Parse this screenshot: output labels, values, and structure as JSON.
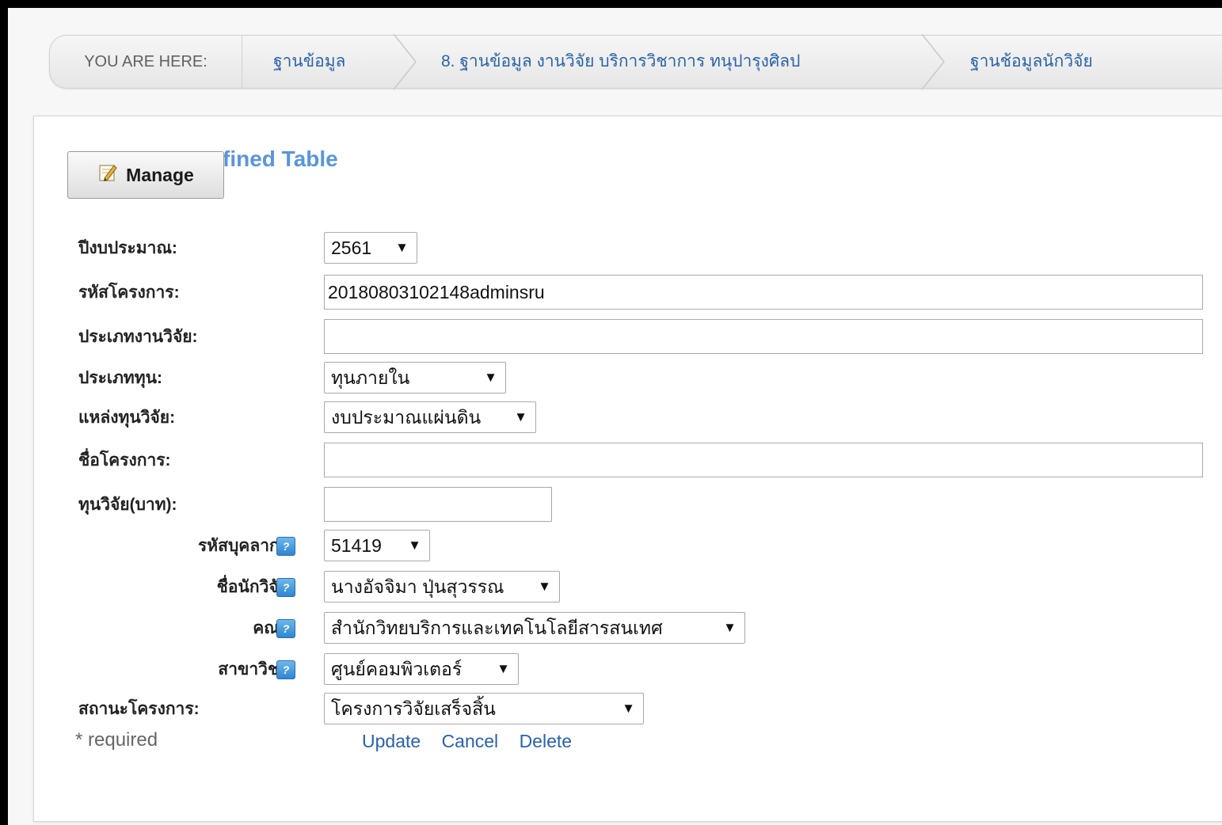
{
  "breadcrumb": {
    "you_are_here": "YOU ARE HERE:",
    "items": [
      "ฐานข้อมูล",
      "8. ฐานข้อมูล งานวิจัย บริการวิชาการ ทนุปารุงศิลป",
      "ฐานช้อมูลนักวิจัย"
    ]
  },
  "panel": {
    "title": "fined Table",
    "manage_label": "Manage"
  },
  "form": {
    "year_label": "ปีงบประมาณ:",
    "year_value": "2561",
    "project_code_label": "รหัสโครงการ:",
    "project_code_value": "20180803102148adminsru",
    "research_type_label": "ประเภทงานวิจัย:",
    "research_type_value": "",
    "fund_type_label": "ประเภททุน:",
    "fund_type_value": "ทุนภายใน",
    "fund_source_label": "แหล่งทุนวิจัย:",
    "fund_source_value": "งบประมาณแผ่นดิน",
    "project_name_label": "ชื่อโครงการ:",
    "project_name_value": "",
    "budget_label": "ทุนวิจัย(บาท):",
    "budget_value": "",
    "staff_id_label": "รหัสบุคลากร:",
    "staff_id_value": "51419",
    "researcher_label": "ชื่อนักวิจัย:",
    "researcher_value": "นางอัจจิมา ปุ่นสุวรรณ",
    "faculty_label": "คณะ:",
    "faculty_value": "สำนักวิทยบริการและเทคโนโลยีสารสนเทศ",
    "major_label": "สาขาวิชา:",
    "major_value": "ศูนย์คอมพิวเตอร์",
    "status_label": "สถานะโครงการ:",
    "status_value": "โครงการวิจัยเสร็จสิ้น",
    "help_glyph": "?"
  },
  "footer": {
    "required_note": "* required",
    "update_label": "Update",
    "cancel_label": "Cancel",
    "delete_label": "Delete"
  },
  "colors": {
    "link": "#2a62a6",
    "title": "#5b95d8",
    "help": "#2f86cf"
  },
  "icons": {
    "manage": "pencil-note-icon",
    "help": "help-icon",
    "dropdown": "dropdown-arrow-icon",
    "separator": "chevron-separator"
  }
}
